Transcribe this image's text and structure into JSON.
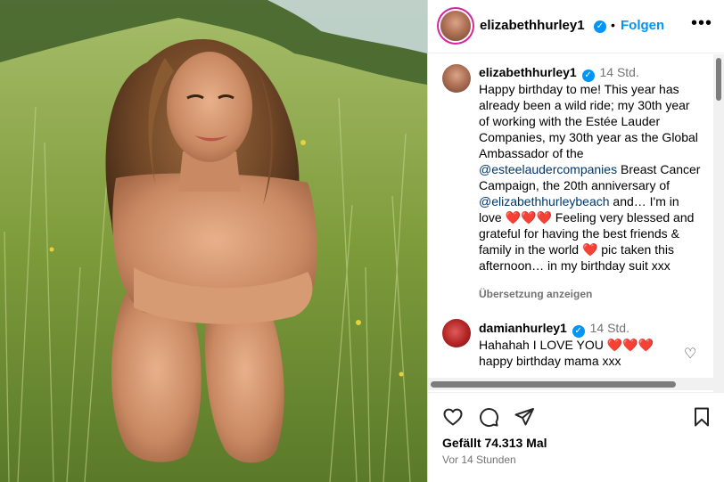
{
  "post": {
    "author": "elizabethhurley1",
    "follow_label": "Folgen",
    "separator": "•"
  },
  "caption": {
    "user": "elizabethhurley1",
    "time": "14 Std.",
    "text_1": "Happy birthday to me! This year has already been a wild ride; my 30th year of working with the Estée Lauder Companies, my 30th year as the Global Ambassador of the",
    "mention_1": "@esteelaudercompanies",
    "text_2": "Breast Cancer Campaign, the 20th anniversary of",
    "mention_2": "@elizabethhurleybeach",
    "text_3": "and… I'm in love",
    "hearts_1": "❤️❤️❤️",
    "text_4": "Feeling very blessed and grateful for having the best friends & family in the world",
    "heart_2": "❤️",
    "text_5": "pic taken this afternoon… in my birthday suit xxx",
    "translate_label": "Übersetzung anzeigen"
  },
  "comment": {
    "user": "damianhurley1",
    "time": "14 Std.",
    "text_1": "Hahahah I LOVE YOU",
    "hearts": "❤️❤️❤️",
    "text_2": "happy birthday mama xxx"
  },
  "footer": {
    "likes": "Gefällt 74.313 Mal",
    "posted": "Vor 14 Stunden"
  },
  "icons": {
    "like": "heart-outline-icon",
    "comment": "comment-icon",
    "share": "paper-plane-icon",
    "save": "bookmark-icon",
    "more": "more-icon",
    "verified": "verified-badge-icon"
  },
  "colors": {
    "link_blue": "#0095f6",
    "mention": "#00376b",
    "muted": "#737373",
    "heart_red": "#d4131b"
  }
}
